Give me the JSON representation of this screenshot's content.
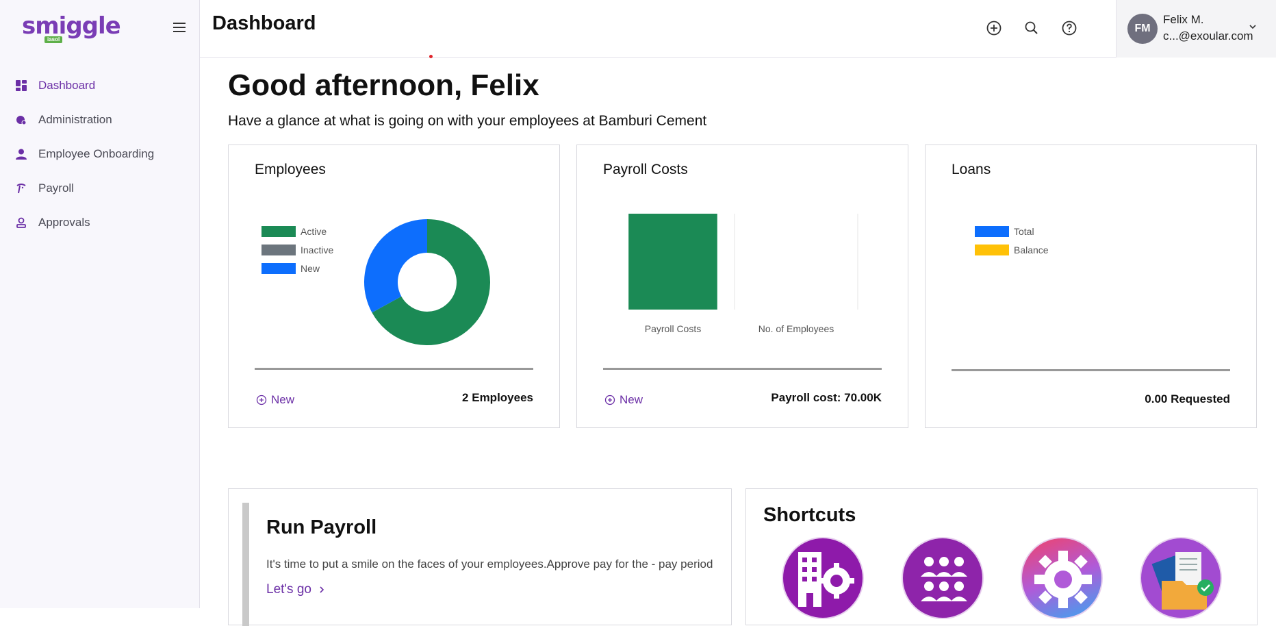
{
  "app": {
    "logo_text": "smiggle",
    "logo_tag": "iasol",
    "brand_color": "#6b2fa6"
  },
  "sidebar": {
    "items": [
      {
        "label": "Dashboard",
        "icon": "dashboard-grid-icon",
        "active": true
      },
      {
        "label": "Administration",
        "icon": "admin-shield-icon",
        "active": false
      },
      {
        "label": "Employee Onboarding",
        "icon": "user-icon",
        "active": false
      },
      {
        "label": "Payroll",
        "icon": "payroll-wave-icon",
        "active": false
      },
      {
        "label": "Approvals",
        "icon": "approval-user-icon",
        "active": false
      }
    ]
  },
  "header": {
    "title": "Dashboard",
    "icons": [
      "plus-circle-icon",
      "search-icon",
      "help-icon"
    ],
    "user": {
      "initials": "FM",
      "name": "Felix M.",
      "email": "c...@exoular.com"
    }
  },
  "main": {
    "greeting": "Good afternoon, Felix",
    "subgreeting": "Have a glance at what is going on with your employees at Bamburi Cement",
    "cards": {
      "employees": {
        "title": "Employees",
        "legend": [
          {
            "label": "Active",
            "color": "#1b8a55"
          },
          {
            "label": "Inactive",
            "color": "#6c757d"
          },
          {
            "label": "New",
            "color": "#0d6efd"
          }
        ],
        "new_label": "New",
        "summary": "2 Employees"
      },
      "payroll": {
        "title": "Payroll Costs",
        "new_label": "New",
        "summary": "Payroll cost: 70.00K"
      },
      "loans": {
        "title": "Loans",
        "legend": [
          {
            "label": "Total",
            "color": "#0d6efd"
          },
          {
            "label": "Balance",
            "color": "#ffc107"
          }
        ],
        "summary": "0.00 Requested"
      }
    },
    "run_payroll": {
      "title": "Run Payroll",
      "text": "It's time to put a smile on the faces of your employees.Approve pay for the - pay period",
      "link": "Let's go"
    },
    "shortcuts": {
      "title": "Shortcuts",
      "items": [
        "company-settings-icon",
        "employees-group-icon",
        "settings-gear-icon",
        "documents-approved-icon"
      ]
    }
  },
  "chart_data": [
    {
      "type": "pie",
      "title": "",
      "donut": true,
      "labels": [
        "Active",
        "Inactive",
        "New"
      ],
      "values": [
        67,
        0,
        33
      ],
      "colors": [
        "#1b8a55",
        "#6c757d",
        "#0d6efd"
      ]
    },
    {
      "type": "bar",
      "categories": [
        "Payroll Costs",
        "No. of Employees"
      ],
      "values": [
        70000,
        2
      ],
      "colors": [
        "#1b8a55",
        "#1b8a55"
      ]
    },
    {
      "type": "pie",
      "labels": [
        "Total",
        "Balance"
      ],
      "values": [
        0,
        0
      ],
      "colors": [
        "#0d6efd",
        "#ffc107"
      ]
    }
  ]
}
